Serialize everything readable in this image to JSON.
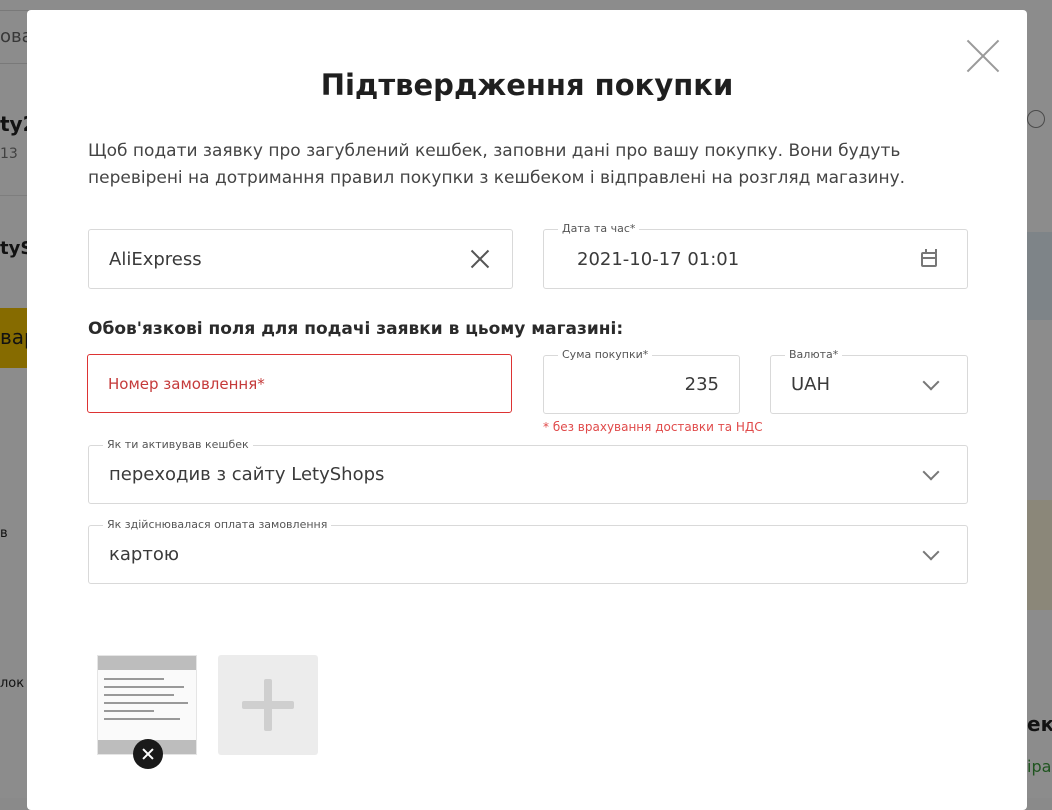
{
  "background": {
    "search_fragment": "ова",
    "left_frags": [
      "ty2",
      "13",
      "tySh",
      "вар",
      "в",
      "лок"
    ],
    "right_frags": [
      "ек",
      "ірах"
    ]
  },
  "modal": {
    "title": "Підтвердження покупки",
    "description": "Щоб подати заявку про загублений кешбек, заповни дані про вашу покупку. Вони будуть перевірені на дотримання правил покупки з кешбеком і відправлені на розгляд магазину.",
    "store": {
      "value": "AliExpress"
    },
    "datetime": {
      "label": "Дата та час*",
      "value": "2021-10-17 01:01"
    },
    "required_section_title": "Обов'язкові поля для подачі заявки в цьому магазині:",
    "order_number": {
      "placeholder": "Номер замовлення*"
    },
    "amount": {
      "label": "Сума покупки*",
      "value": "235"
    },
    "currency": {
      "label": "Валюта*",
      "value": "UAH"
    },
    "amount_hint": "* без врахування доставки та НДС",
    "activation": {
      "label": "Як ти активував кешбек",
      "value": "переходив з сайту LetyShops"
    },
    "payment": {
      "label": "Як здійснювалася оплата замовлення",
      "value": "картою"
    }
  }
}
